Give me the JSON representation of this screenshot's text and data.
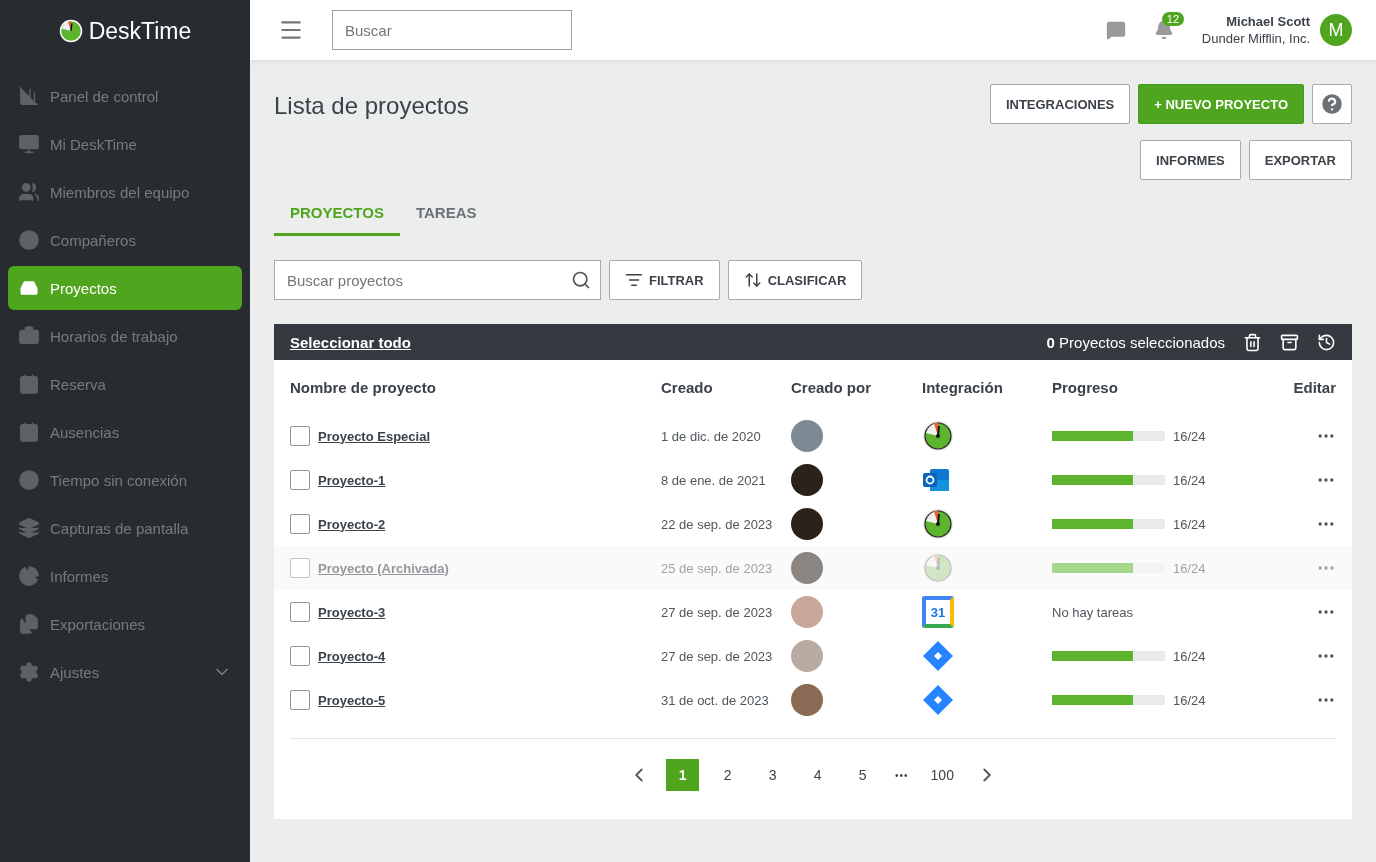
{
  "brand": {
    "name": "DeskTime"
  },
  "sidebar": {
    "items": [
      {
        "label": "Panel de control",
        "selected": false
      },
      {
        "label": "Mi DeskTime",
        "selected": false
      },
      {
        "label": "Miembros del equipo",
        "selected": false
      },
      {
        "label": "Compañeros",
        "selected": false
      },
      {
        "label": "Proyectos",
        "selected": true
      },
      {
        "label": "Horarios de trabajo",
        "selected": false
      },
      {
        "label": "Reserva",
        "selected": false
      },
      {
        "label": "Ausencias",
        "selected": false
      },
      {
        "label": "Tiempo sin conexión",
        "selected": false
      },
      {
        "label": "Capturas de pantalla",
        "selected": false
      },
      {
        "label": "Informes",
        "selected": false
      },
      {
        "label": "Exportaciones",
        "selected": false
      },
      {
        "label": "Ajustes",
        "selected": false,
        "expanded": false
      }
    ]
  },
  "topbar": {
    "search": {
      "placeholder": "Buscar"
    },
    "notifications": "12",
    "user": {
      "name": "Michael Scott",
      "company": "Dunder Mifflin, Inc.",
      "initial": "M"
    }
  },
  "page": {
    "title": "Lista de proyectos",
    "buttons": [
      {
        "label": "INTEGRACIONES",
        "kind": "outline"
      },
      {
        "label": "+ NUEVO PROYECTO",
        "kind": "primary"
      },
      {
        "label": "INFORMES",
        "kind": "outline"
      },
      {
        "label": "EXPORTAR",
        "kind": "outline"
      }
    ]
  },
  "tabs": [
    {
      "label": "PROYECTOS",
      "selected": true
    },
    {
      "label": "TAREAS",
      "selected": false
    }
  ],
  "filters": {
    "search": {
      "placeholder": "Buscar proyectos"
    },
    "filter": "FILTRAR",
    "sort": "CLASIFICAR"
  },
  "selection_bar": {
    "select_all": "Seleccionar todo",
    "count": "**0** Proyectos seleccionados"
  },
  "table": {
    "columns": [
      "Nombre de proyecto",
      "Creado",
      "Creado por",
      "Integración",
      "Progreso",
      "Editar"
    ],
    "rows": [
      {
        "name": "Proyecto Especial",
        "created": "1 de dic. de 2020",
        "checked": false,
        "archived": false,
        "integration": {
          "kind": "desktime"
        },
        "progress": {
          "kind": "bar",
          "level": 0.72,
          "text": "16/24"
        }
      },
      {
        "name": "Proyecto-1",
        "created": "8 de ene. de 2021",
        "checked": false,
        "archived": false,
        "integration": {
          "kind": "outlook"
        },
        "progress": {
          "kind": "bar",
          "level": 0.72,
          "text": "16/24"
        }
      },
      {
        "name": "Proyecto-2",
        "created": "22 de sep. de 2023",
        "checked": false,
        "archived": false,
        "integration": {
          "kind": "desktime"
        },
        "progress": {
          "kind": "bar",
          "level": 0.72,
          "text": "16/24"
        }
      },
      {
        "name": "Proyecto (Archivada)",
        "created": "25 de sep. de 2023",
        "checked": false,
        "archived": true,
        "integration": {
          "kind": "desktime"
        },
        "progress": {
          "kind": "bar",
          "level": 0.72,
          "text": "16/24"
        }
      },
      {
        "name": "Proyecto-3",
        "created": "27 de sep. de 2023",
        "checked": false,
        "archived": false,
        "integration": {
          "kind": "calendar",
          "text": "31"
        },
        "progress": {
          "kind": "text",
          "text": "No hay tareas"
        }
      },
      {
        "name": "Proyecto-4",
        "created": "27 de sep. de 2023",
        "checked": false,
        "archived": false,
        "integration": {
          "kind": "jira"
        },
        "progress": {
          "kind": "bar",
          "level": 0.72,
          "text": "16/24"
        }
      },
      {
        "name": "Proyecto-5",
        "created": "31 de oct. de 2023",
        "checked": false,
        "archived": false,
        "integration": {
          "kind": "jira"
        },
        "progress": {
          "kind": "bar",
          "level": 0.72,
          "text": "16/24"
        }
      }
    ]
  },
  "pagination": {
    "pages": [
      {
        "label": "1",
        "selected": true
      },
      {
        "label": "2",
        "selected": false
      },
      {
        "label": "3",
        "selected": false
      },
      {
        "label": "4",
        "selected": false
      },
      {
        "label": "5",
        "selected": false
      },
      {
        "label": "•••",
        "selected": false,
        "kind": "ellipsis"
      },
      {
        "label": "100",
        "selected": false
      }
    ]
  }
}
